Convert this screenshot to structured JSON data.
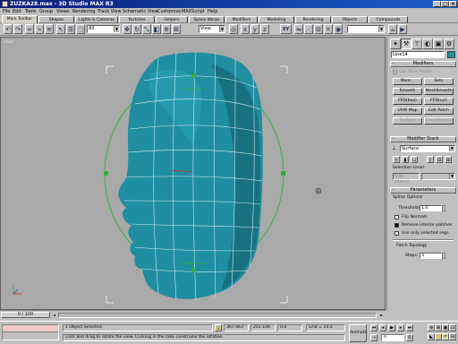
{
  "window": {
    "title": "ZUZKA28.max - 3D Studio MAX R3",
    "minimize_glyph": "_",
    "maximize_glyph": "□",
    "close_glyph": "×"
  },
  "menu": [
    "File",
    "Edit",
    "Tools",
    "Group",
    "Views",
    "Rendering",
    "Track View",
    "Schematic View",
    "Customize",
    "MAXScript",
    "Help"
  ],
  "tabs": [
    "Main Toolbar",
    "Shapes",
    "Lights & Cameras",
    "Particles",
    "Helpers",
    "Space Warps",
    "Modifiers",
    "Modeling",
    "Rendering",
    "Objects",
    "Compounds"
  ],
  "toolbar": {
    "selection_filter": "All",
    "coord_system": "View",
    "named_selection": "",
    "icons": [
      "undo-icon",
      "redo-icon",
      "link-icon",
      "unlink-icon",
      "bind-icon",
      "select-icon",
      "select-by-name-icon",
      "select-region-icon",
      "move-icon",
      "rotate-icon",
      "scale-icon",
      "pivot-icon",
      "axis-x-icon",
      "axis-y-icon",
      "axis-xy-icon",
      "mirror-icon",
      "array-icon",
      "align-icon",
      "schematic-icon",
      "material-editor-icon",
      "render-scene-icon",
      "quick-render-icon"
    ],
    "axis_label": "XY"
  },
  "viewport": {
    "label": "User",
    "mesh_color": "#1f8ea0",
    "background": "#a9a9a9"
  },
  "command_panel": {
    "tabs": [
      "create-icon",
      "modify-icon",
      "hierarchy-icon",
      "motion-icon",
      "display-icon",
      "utilities-icon"
    ],
    "object_name": "Line14",
    "object_color": "#1f8ea0",
    "modifiers_title": "Modifiers",
    "use_pivot_points": "Use Pivot Points",
    "modifier_buttons": [
      "More...",
      "Sets",
      "Smooth",
      "MeshSmooth",
      "FFD(box)",
      "FFD(cyl)",
      "UVW Map",
      "Edit Patch",
      "Surface",
      "CrossSection"
    ],
    "modifier_stack_title": "Modifier Stack",
    "stack_current": "Surface",
    "selection_level_label": "Selection Level:",
    "selection_level_left": "Sub-Object",
    "parameters_title": "Parameters",
    "spline_options_label": "Spline Options",
    "threshold_label": "Threshold:",
    "threshold_value": "1.0",
    "flip_normals": "Flip Normals",
    "remove_interior": "Remove interior patches",
    "use_only_selected": "Use only selected segs.",
    "patch_topology_label": "Patch Topology",
    "steps_label": "Steps:",
    "steps_value": "3"
  },
  "timebar": {
    "frame": "0 / 100",
    "left_arrow": "◄",
    "right_arrow": "►"
  },
  "status": {
    "selection": "1 Object Selected",
    "prompt": "Click and drag to rotate the view.  Clicking in the tabs constrains the rotation",
    "x": "367.963",
    "y": "251.106",
    "z": "0.0",
    "grid": "Grid = 10.0",
    "animate": "Animate",
    "frame_field": "0",
    "lock_icon": "lock-icon"
  }
}
